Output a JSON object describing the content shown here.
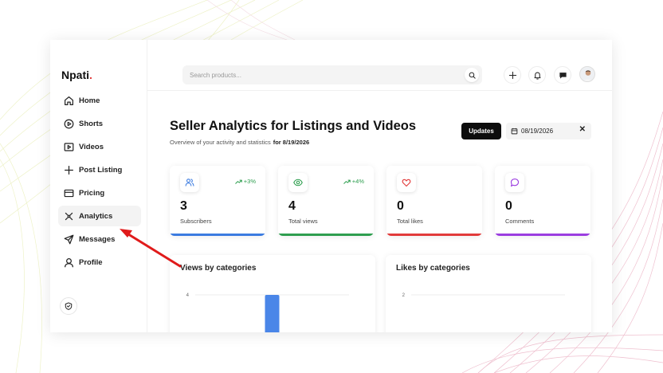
{
  "app": {
    "logo_text": "Npati",
    "logo_dot": "."
  },
  "sidebar": {
    "items": [
      {
        "label": "Home",
        "icon": "home-icon"
      },
      {
        "label": "Shorts",
        "icon": "play-circle-icon"
      },
      {
        "label": "Videos",
        "icon": "video-icon"
      },
      {
        "label": "Post Listing",
        "icon": "plus-icon"
      },
      {
        "label": "Pricing",
        "icon": "credit-card-icon"
      },
      {
        "label": "Analytics",
        "icon": "analytics-icon",
        "active": true
      },
      {
        "label": "Messages",
        "icon": "send-icon"
      },
      {
        "label": "Profile",
        "icon": "user-icon"
      }
    ]
  },
  "search": {
    "placeholder": "Search products..."
  },
  "header": {
    "title": "Seller Analytics for Listings and Videos",
    "subtitle": "Overview of your activity and statistics",
    "subtitle_date": "for 8/19/2026",
    "updates_label": "Updates",
    "date_value": "08/19/2026",
    "clear_symbol": "✕"
  },
  "stats": [
    {
      "value": "3",
      "label": "Subscribers",
      "trend": "+3%",
      "icon": "users-icon",
      "color": "#3b7be0"
    },
    {
      "value": "4",
      "label": "Total views",
      "trend": "+4%",
      "icon": "eye-icon",
      "color": "#2e9e4f"
    },
    {
      "value": "0",
      "label": "Total likes",
      "trend": "",
      "icon": "heart-icon",
      "color": "#e23b3b"
    },
    {
      "value": "0",
      "label": "Comments",
      "trend": "",
      "icon": "comment-icon",
      "color": "#9b3de0"
    }
  ],
  "charts": {
    "views_title": "Views by categories",
    "likes_title": "Likes by categories"
  },
  "chart_data": [
    {
      "type": "bar",
      "title": "Views by categories",
      "categories": [
        ""
      ],
      "values": [
        4
      ],
      "ylim": [
        0,
        4
      ],
      "y_ticks": [
        "4"
      ],
      "color": "#4a86e8"
    },
    {
      "type": "bar",
      "title": "Likes by categories",
      "categories": [],
      "values": [],
      "ylim": [
        0,
        2
      ],
      "y_ticks": [
        "2"
      ]
    }
  ],
  "colors": {
    "accent": "#0d0d0d",
    "annotation_arrow": "#e01b1b"
  }
}
